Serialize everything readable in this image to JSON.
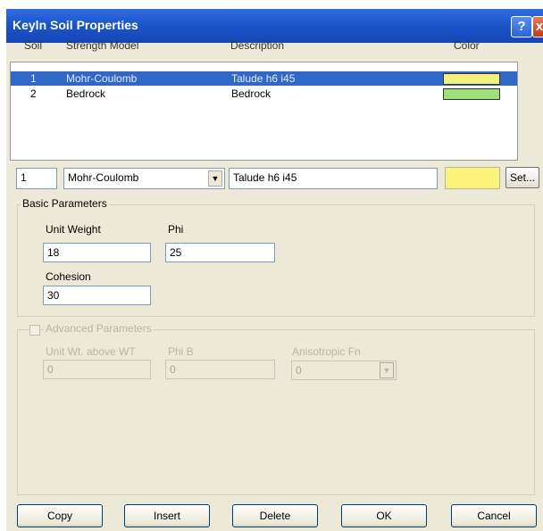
{
  "window": {
    "title": "Keyln Soil Properties",
    "help_glyph": "?",
    "close_glyph": "x"
  },
  "table": {
    "headers": [
      "Soil",
      "Strength Model",
      "Description",
      "Color"
    ],
    "rows": [
      {
        "soil": "1",
        "model": "Mohr-Coulomb",
        "description": "Talude h6 i45",
        "color": "#f2f07a",
        "selected": true
      },
      {
        "soil": "2",
        "model": "Bedrock",
        "description": "Bedrock",
        "color": "#9ee07a",
        "selected": false
      }
    ]
  },
  "editor": {
    "soil_number": "1",
    "strength_model": "Mohr-Coulomb",
    "dropdown_arrow": "▼",
    "description": "Talude h6 i45",
    "color": "#fbf37a",
    "set_label": "Set..."
  },
  "basic": {
    "title": "Basic Parameters",
    "unit_weight_label": "Unit Weight",
    "unit_weight_value": "18",
    "phi_label": "Phi",
    "phi_value": "25",
    "cohesion_label": "Cohesion",
    "cohesion_value": "30"
  },
  "advanced": {
    "title": "Advanced Parameters",
    "checked": false,
    "unit_wt_label": "Unit Wt. above WT",
    "unit_wt_value": "0",
    "phi_b_label": "Phi B",
    "phi_b_value": "0",
    "anisotropic_label": "Anisotropic Fn",
    "anisotropic_value": "0",
    "dropdown_arrow": "▼"
  },
  "buttons": {
    "copy": "Copy",
    "insert": "Insert",
    "delete": "Delete",
    "ok": "OK",
    "cancel": "Cancel"
  }
}
